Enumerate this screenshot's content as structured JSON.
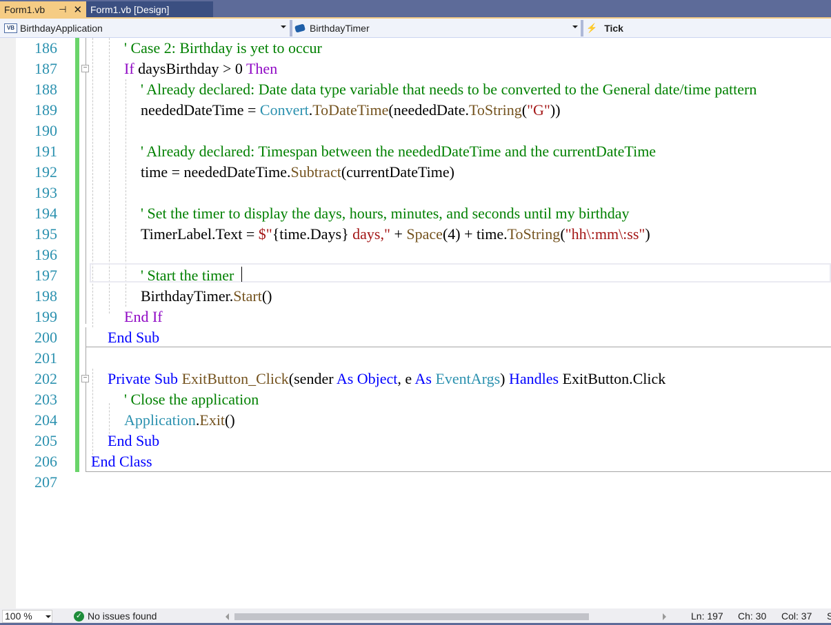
{
  "tabs": [
    {
      "label": "Form1.vb",
      "active": true,
      "pin_icon": "pin-icon",
      "close_icon": "close-icon"
    },
    {
      "label": "Form1.vb [Design]",
      "active": false
    }
  ],
  "navbar": {
    "project": {
      "icon": "vb-project-icon",
      "icon_text": "VB",
      "label": "BirthdayApplication"
    },
    "object": {
      "icon": "component-icon",
      "label": "BirthdayTimer"
    },
    "event": {
      "icon": "lightning-icon",
      "label": "Tick"
    }
  },
  "editor": {
    "lines": [
      {
        "num": "186",
        "indent": 2,
        "tokens": [
          {
            "c": "c",
            "t": "' Case 2: Birthday is yet to occur"
          }
        ]
      },
      {
        "num": "187",
        "indent": 2,
        "tokens": [
          {
            "c": "kc",
            "t": "If"
          },
          {
            "c": "",
            "t": " daysBirthday > 0 "
          },
          {
            "c": "kc",
            "t": "Then"
          }
        ]
      },
      {
        "num": "188",
        "indent": 3,
        "tokens": [
          {
            "c": "c",
            "t": "' Already declared: Date data type variable that needs to be converted to the General date/time pattern"
          }
        ]
      },
      {
        "num": "189",
        "indent": 3,
        "tokens": [
          {
            "c": "",
            "t": "neededDateTime = "
          },
          {
            "c": "t",
            "t": "Convert"
          },
          {
            "c": "",
            "t": "."
          },
          {
            "c": "m",
            "t": "ToDateTime"
          },
          {
            "c": "",
            "t": "(neededDate."
          },
          {
            "c": "m",
            "t": "ToString"
          },
          {
            "c": "",
            "t": "("
          },
          {
            "c": "s",
            "t": "\"G\""
          },
          {
            "c": "",
            "t": "))"
          }
        ]
      },
      {
        "num": "190",
        "indent": 3,
        "tokens": []
      },
      {
        "num": "191",
        "indent": 3,
        "tokens": [
          {
            "c": "c",
            "t": "' Already declared: Timespan between the neededDateTime and the currentDateTime"
          }
        ]
      },
      {
        "num": "192",
        "indent": 3,
        "tokens": [
          {
            "c": "",
            "t": "time = neededDateTime."
          },
          {
            "c": "m",
            "t": "Subtract"
          },
          {
            "c": "",
            "t": "(currentDateTime)"
          }
        ]
      },
      {
        "num": "193",
        "indent": 3,
        "tokens": []
      },
      {
        "num": "194",
        "indent": 3,
        "tokens": [
          {
            "c": "c",
            "t": "' Set the timer to display the days, hours, minutes, and seconds until my birthday"
          }
        ]
      },
      {
        "num": "195",
        "indent": 3,
        "tokens": [
          {
            "c": "",
            "t": "TimerLabel.Text = "
          },
          {
            "c": "s",
            "t": "$\""
          },
          {
            "c": "",
            "t": "{time.Days}"
          },
          {
            "c": "s",
            "t": " days,\""
          },
          {
            "c": "",
            "t": " + "
          },
          {
            "c": "m",
            "t": "Space"
          },
          {
            "c": "",
            "t": "(4) + time."
          },
          {
            "c": "m",
            "t": "ToString"
          },
          {
            "c": "",
            "t": "("
          },
          {
            "c": "s",
            "t": "\"hh\\:mm\\:ss\""
          },
          {
            "c": "",
            "t": ")"
          }
        ]
      },
      {
        "num": "196",
        "indent": 3,
        "tokens": []
      },
      {
        "num": "197",
        "indent": 3,
        "tokens": [
          {
            "c": "c",
            "t": "' Start the timer"
          }
        ]
      },
      {
        "num": "198",
        "indent": 3,
        "tokens": [
          {
            "c": "",
            "t": "BirthdayTimer."
          },
          {
            "c": "m",
            "t": "Start"
          },
          {
            "c": "",
            "t": "()"
          }
        ]
      },
      {
        "num": "199",
        "indent": 2,
        "tokens": [
          {
            "c": "kc",
            "t": "End If"
          }
        ]
      },
      {
        "num": "200",
        "indent": 1,
        "tokens": [
          {
            "c": "k",
            "t": "End Sub"
          }
        ]
      },
      {
        "num": "201",
        "indent": 1,
        "tokens": []
      },
      {
        "num": "202",
        "indent": 1,
        "tokens": [
          {
            "c": "k",
            "t": "Private Sub "
          },
          {
            "c": "m",
            "t": "ExitButton_Click"
          },
          {
            "c": "",
            "t": "(sender "
          },
          {
            "c": "k",
            "t": "As Object"
          },
          {
            "c": "",
            "t": ", e "
          },
          {
            "c": "k",
            "t": "As "
          },
          {
            "c": "t",
            "t": "EventArgs"
          },
          {
            "c": "",
            "t": ") "
          },
          {
            "c": "k",
            "t": "Handles"
          },
          {
            "c": "",
            "t": " ExitButton.Click"
          }
        ]
      },
      {
        "num": "203",
        "indent": 2,
        "tokens": [
          {
            "c": "c",
            "t": "' Close the application"
          }
        ]
      },
      {
        "num": "204",
        "indent": 2,
        "tokens": [
          {
            "c": "t",
            "t": "Application"
          },
          {
            "c": "",
            "t": "."
          },
          {
            "c": "m",
            "t": "Exit"
          },
          {
            "c": "",
            "t": "()"
          }
        ]
      },
      {
        "num": "205",
        "indent": 1,
        "tokens": [
          {
            "c": "k",
            "t": "End Sub"
          }
        ]
      },
      {
        "num": "206",
        "indent": 0,
        "tokens": [
          {
            "c": "k",
            "t": "End Class"
          }
        ]
      },
      {
        "num": "207",
        "indent": 0,
        "tokens": []
      }
    ]
  },
  "statusbar": {
    "zoom": "100 %",
    "issues_icon": "check-circle-icon",
    "issues": "No issues found",
    "ln": "Ln: 197",
    "ch": "Ch: 30",
    "col": "Col: 37",
    "extra": "S"
  },
  "colors": {
    "keyword": "#0000ff",
    "control_keyword": "#8f08c4",
    "comment": "#008000",
    "type": "#2b91af",
    "method": "#74531f",
    "string": "#a31515",
    "line_number": "#2b91af",
    "change_bar": "#6ad46a",
    "active_tab": "#f5cc84"
  }
}
